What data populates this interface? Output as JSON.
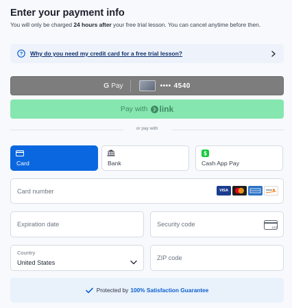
{
  "header": {
    "title": "Enter your payment info",
    "desc_prefix": "You will only be charged ",
    "desc_bold": "24 hours after",
    "desc_suffix": " your free trial lesson. You can cancel anytime before then."
  },
  "faq": {
    "text": "Why do you need my credit card for a free trial lesson?",
    "icon": "question-circle-icon",
    "chevron": "chevron-right-icon"
  },
  "google_pay": {
    "brand": "Pay",
    "card_dots": "••••",
    "card_last4": "4540"
  },
  "link_pay": {
    "prefix": "Pay with",
    "brand": "link"
  },
  "divider": {
    "text": "or pay with"
  },
  "methods": [
    {
      "label": "Card",
      "icon": "card-icon",
      "active": true
    },
    {
      "label": "Bank",
      "icon": "bank-icon",
      "active": false
    },
    {
      "label": "Cash App Pay",
      "icon": "cashapp-icon",
      "active": false
    }
  ],
  "form": {
    "card_number_placeholder": "Card number",
    "expiration_placeholder": "Expiration date",
    "security_placeholder": "Security code",
    "country_label": "Country",
    "country_value": "United States",
    "zip_placeholder": "ZIP code",
    "card_brands": [
      "VISA",
      "Mastercard",
      "AMERICAN EXPRESS",
      "DISCOVER"
    ]
  },
  "guarantee": {
    "prefix": "Protected by",
    "link": "100% Satisfaction Guarantee"
  },
  "colors": {
    "primary": "#0a67e0",
    "link_green": "#86e6b0",
    "gpay_gray": "#7d7d7d",
    "background": "#f7f9fc"
  }
}
